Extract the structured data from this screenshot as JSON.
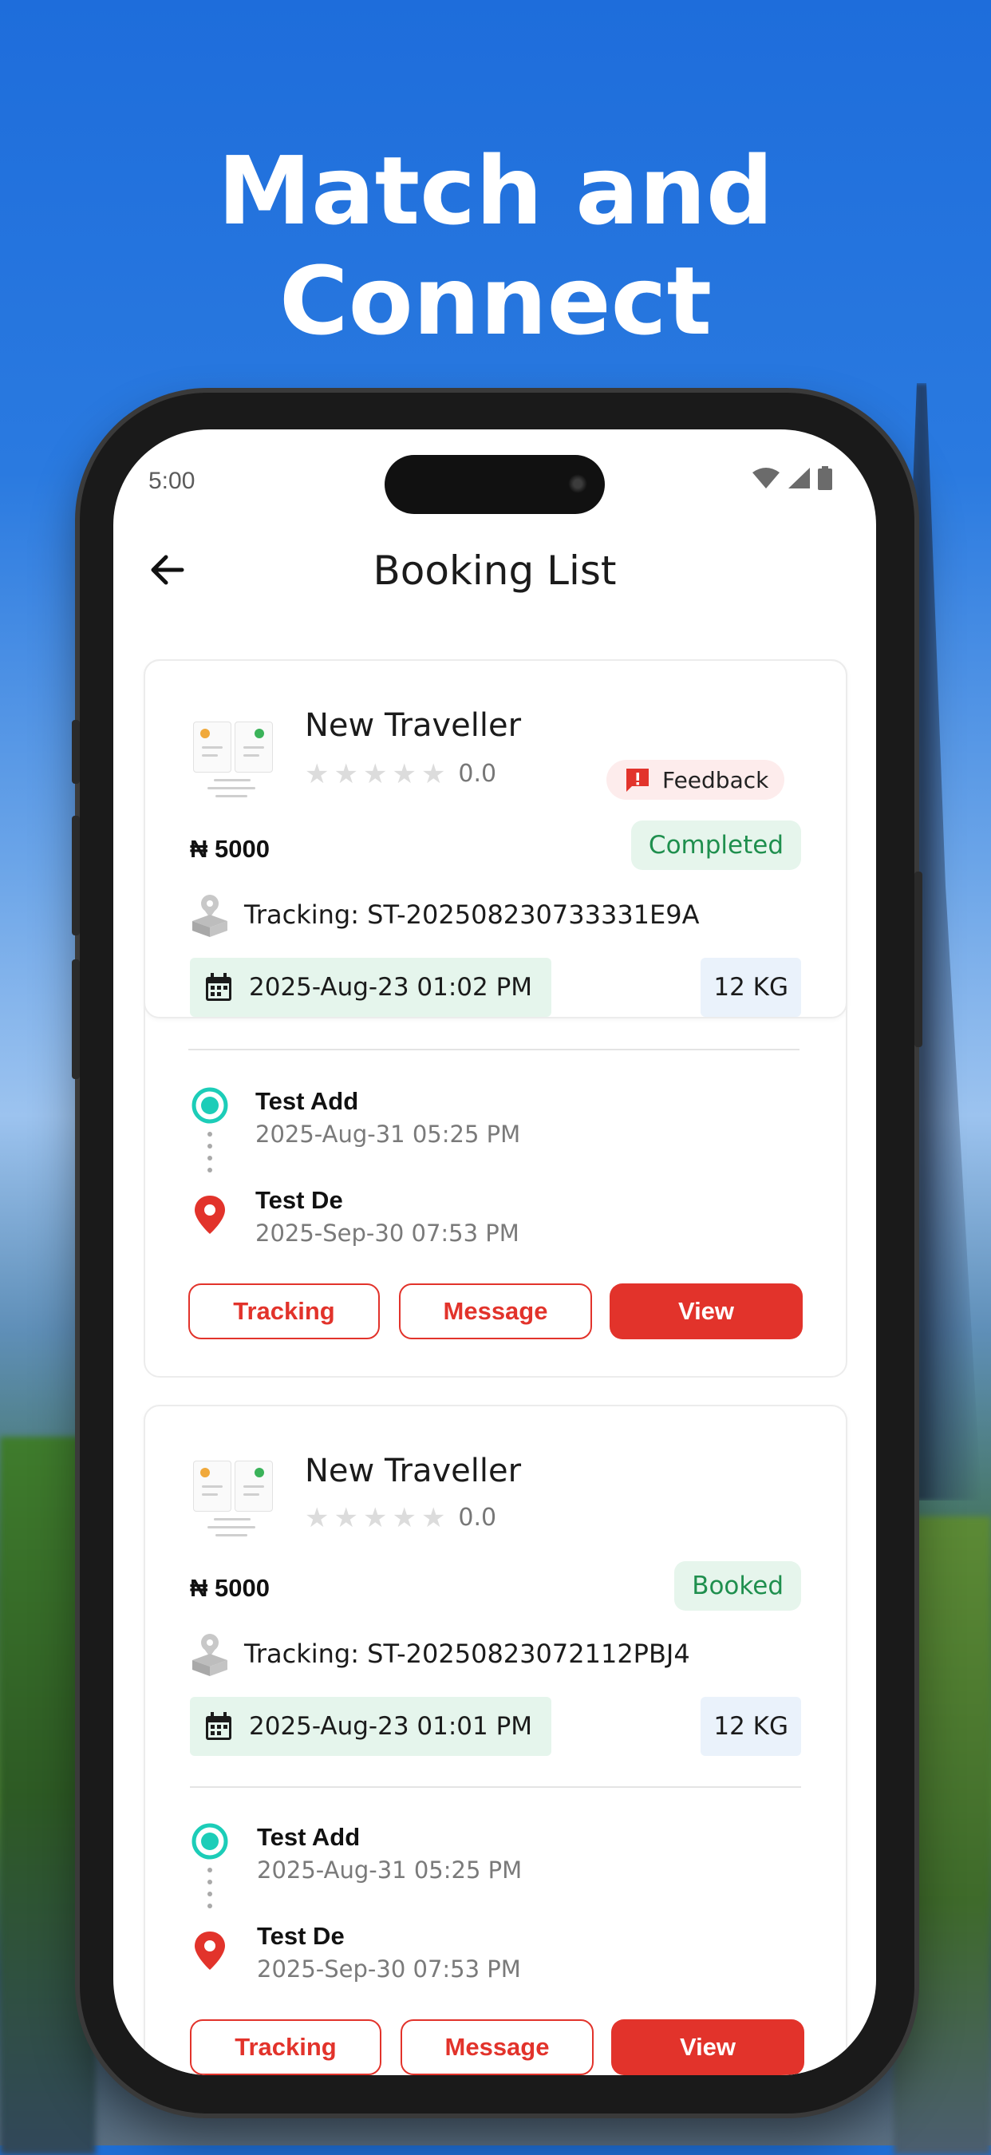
{
  "promo": {
    "headline": "Match and Connect"
  },
  "status_bar": {
    "time": "5:00"
  },
  "header": {
    "title": "Booking List"
  },
  "bookings": [
    {
      "traveller_name": "New Traveller",
      "rating": "0.0",
      "stars_filled": 0,
      "feedback_label": "Feedback",
      "price": "₦ 5000",
      "status": "Completed",
      "tracking": "Tracking: ST-202508230733331E9A",
      "date": "2025-Aug-23 01:02 PM",
      "weight": "12 KG",
      "pickup": {
        "label": "Test Add",
        "date": "2025-Aug-31 05:25 PM"
      },
      "dropoff": {
        "label": "Test De",
        "date": "2025-Sep-30 07:53 PM"
      },
      "buttons": {
        "tracking": "Tracking",
        "message": "Message",
        "view": "View"
      }
    },
    {
      "traveller_name": "New Traveller",
      "rating": "0.0",
      "stars_filled": 0,
      "price": "₦ 5000",
      "status": "Booked",
      "tracking": "Tracking: ST-20250823072112PBJ4",
      "date": "2025-Aug-23 01:01 PM",
      "weight": "12 KG",
      "pickup": {
        "label": "Test Add",
        "date": "2025-Aug-31 05:25 PM"
      },
      "dropoff": {
        "label": "Test De",
        "date": "2025-Sep-30 07:53 PM"
      },
      "buttons": {
        "tracking": "Tracking",
        "message": "Message",
        "view": "View"
      }
    }
  ],
  "colors": {
    "accent_red": "#e2332b",
    "status_green": "#1f8f4e",
    "pickup_teal": "#1ccdb8",
    "background_blue": "#1f6fd6"
  },
  "icons": [
    "back-arrow-icon",
    "wifi-icon",
    "signal-icon",
    "battery-icon",
    "star-icon",
    "feedback-alert-icon",
    "package-tracking-icon",
    "calendar-icon",
    "pickup-marker-icon",
    "location-pin-icon"
  ]
}
